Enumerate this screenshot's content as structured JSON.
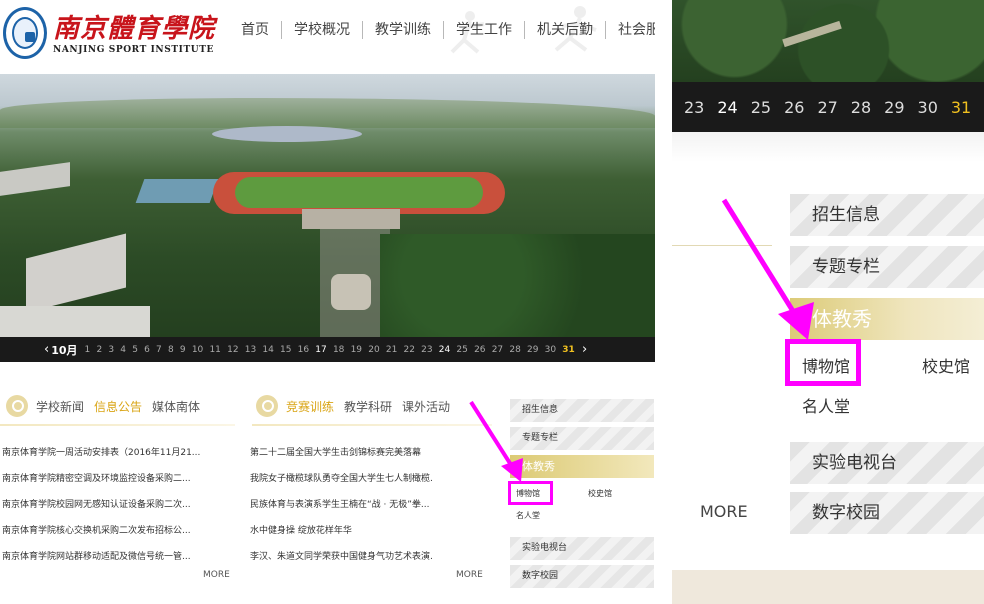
{
  "school": {
    "name_cn": "南京體育學院",
    "name_en": "NANJING  SPORT  INSTITUTE"
  },
  "nav": [
    "首页",
    "学校概况",
    "教学训练",
    "学生工作",
    "机关后勤",
    "社会服务"
  ],
  "calendar": {
    "month": "10月",
    "days": [
      "1",
      "2",
      "3",
      "4",
      "5",
      "6",
      "7",
      "8",
      "9",
      "10",
      "11",
      "12",
      "13",
      "14",
      "15",
      "16",
      "17",
      "18",
      "19",
      "20",
      "21",
      "22",
      "23",
      "24",
      "25",
      "26",
      "27",
      "28",
      "29",
      "30",
      "31"
    ],
    "active_day": "31"
  },
  "news_left": {
    "tabs": [
      "学校新闻",
      "信息公告",
      "媒体南体"
    ],
    "active_tab": "信息公告",
    "items": [
      "南京体育学院一周活动安排表（2016年11月21...",
      "南京体育学院精密空调及环境监控设备采购二...",
      "南京体育学院校园网无感知认证设备采购二次...",
      "南京体育学院核心交换机采购二次发布招标公...",
      "南京体育学院网站群移动适配及微信号统一管..."
    ],
    "more": "MORE"
  },
  "news_right": {
    "tabs": [
      "竞赛训练",
      "教学科研",
      "课外活动"
    ],
    "active_tab": "竞赛训练",
    "items": [
      "第二十二届全国大学生击剑锦标赛完美落幕",
      "我院女子橄榄球队勇夺全国大学生七人制橄榄...",
      "民族体育与表演系学生王楠在“战 · 无极”拳...",
      "水中健身操  绽放花样年华",
      "李汉、朱道文同学荣获中国健身气功艺术表演..."
    ],
    "more": "MORE"
  },
  "sidebar": {
    "items": [
      "招生信息",
      "专题专栏",
      "体教秀",
      "实验电视台",
      "数字校园"
    ],
    "sub_links": [
      "博物馆",
      "校史馆",
      "名人堂"
    ]
  },
  "zoom": {
    "days": [
      "23",
      "24",
      "25",
      "26",
      "27",
      "28",
      "29",
      "30",
      "31"
    ],
    "active_day": "31",
    "more": "MORE"
  },
  "colors": {
    "highlight": "#ff00ff",
    "accent_gold": "#d9a414",
    "calendar_active": "#f0c020",
    "logo_red": "#c8141b",
    "logo_blue": "#1d63a8"
  }
}
